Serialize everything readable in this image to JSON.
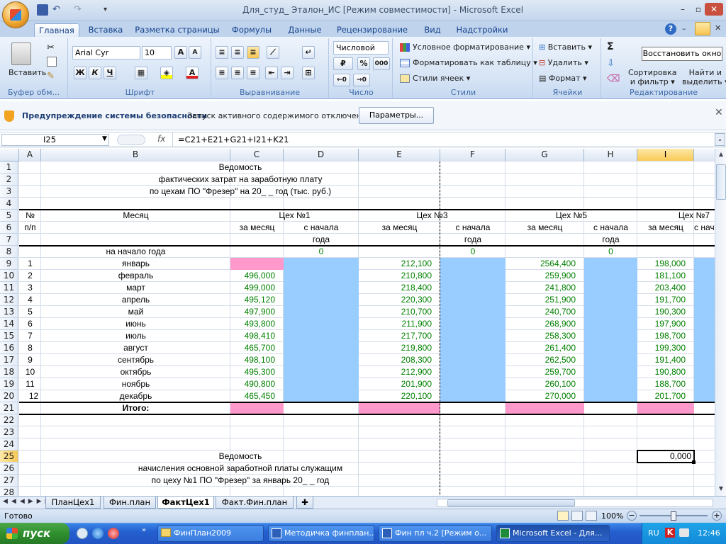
{
  "window": {
    "title": "Для_студ_ Эталон_ИС  [Режим совместимости] - Microsoft Excel"
  },
  "tabs": [
    "Главная",
    "Вставка",
    "Разметка страницы",
    "Формулы",
    "Данные",
    "Рецензирование",
    "Вид",
    "Надстройки"
  ],
  "ribbon": {
    "paste_label": "Вставить",
    "group_clipboard": "Буфер обм...",
    "font_name": "Arial Cyr",
    "font_size": "10",
    "group_font": "Шрифт",
    "group_alignment": "Выравнивание",
    "number_format": "Числовой",
    "group_number": "Число",
    "cond_format": "Условное форматирование",
    "format_table": "Форматировать как таблицу",
    "cell_styles": "Стили ячеек",
    "group_styles": "Стили",
    "insert": "Вставить",
    "delete": "Удалить",
    "format": "Формат",
    "group_cells": "Ячейки",
    "sort_filter_1": "Сортировка",
    "sort_filter_2": "и фильтр",
    "find_1": "Найти и",
    "find_2": "выделить",
    "group_editing": "Редактирование",
    "tooltip": "Восстановить окно",
    "bold": "Ж",
    "italic": "К",
    "underline": "Ч",
    "percent": "%",
    "thousands": "000",
    "sigma": "Σ"
  },
  "security": {
    "title": "Предупреждение системы безопасности",
    "message": "Запуск активного содержимого отключен.",
    "button": "Параметры..."
  },
  "formula_bar": {
    "name_box": "I25",
    "fx": "fx",
    "formula": "=C21+E21+G21+I21+K21"
  },
  "columns": [
    "A",
    "B",
    "C",
    "D",
    "E",
    "F",
    "G",
    "H",
    "I"
  ],
  "rows": [
    "1",
    "2",
    "3",
    "4",
    "5",
    "6",
    "7",
    "8",
    "9",
    "10",
    "11",
    "12",
    "13",
    "14",
    "15",
    "16",
    "17",
    "18",
    "19",
    "20",
    "21",
    "22",
    "23",
    "24",
    "25",
    "26",
    "27",
    "28"
  ],
  "sheet": {
    "title1": "Ведомость",
    "title2": "фактических затрат на заработную плату",
    "title3": "по цехам ПО \"Фрезер\" на 20_ _  год (тыс. руб.)",
    "hdr_num": "№",
    "hdr_pp": "п/п",
    "hdr_month": "Месяц",
    "shop1": "Цех №1",
    "shop3": "Цех №3",
    "shop5": "Цех №5",
    "shop7": "Цех №7",
    "per_month": "за месяц",
    "since_start_1": "с начала",
    "since_start_2": "года",
    "start_of_year": "на начало года",
    "zero": "0",
    "total": "Итого:",
    "i25": "0,000",
    "title4": "Ведомость",
    "title5": "начисления основной заработной платы служащим",
    "title6": "по цеху №1 ПО \"Фрезер\" за январь 20_ _  год",
    "data": [
      {
        "n": "1",
        "m": "январь",
        "c": "",
        "e": "212,100",
        "g": "2564,400",
        "i": "198,000"
      },
      {
        "n": "2",
        "m": "февраль",
        "c": "496,000",
        "e": "210,800",
        "g": "259,900",
        "i": "181,100"
      },
      {
        "n": "3",
        "m": "март",
        "c": "499,000",
        "e": "218,400",
        "g": "241,800",
        "i": "203,400"
      },
      {
        "n": "4",
        "m": "апрель",
        "c": "495,120",
        "e": "220,300",
        "g": "251,900",
        "i": "191,700"
      },
      {
        "n": "5",
        "m": "май",
        "c": "497,900",
        "e": "210,700",
        "g": "240,700",
        "i": "190,300"
      },
      {
        "n": "6",
        "m": "июнь",
        "c": "493,800",
        "e": "211,900",
        "g": "268,900",
        "i": "197,900"
      },
      {
        "n": "7",
        "m": "июль",
        "c": "498,410",
        "e": "217,700",
        "g": "258,300",
        "i": "198,700"
      },
      {
        "n": "8",
        "m": "август",
        "c": "465,700",
        "e": "219,800",
        "g": "261,400",
        "i": "199,300"
      },
      {
        "n": "9",
        "m": "сентябрь",
        "c": "498,100",
        "e": "208,300",
        "g": "262,500",
        "i": "191,400"
      },
      {
        "n": "10",
        "m": "октябрь",
        "c": "495,300",
        "e": "212,900",
        "g": "259,700",
        "i": "190,800"
      },
      {
        "n": "11",
        "m": "ноябрь",
        "c": "490,800",
        "e": "201,900",
        "g": "260,100",
        "i": "188,700"
      },
      {
        "n": "12",
        "m": "декабрь",
        "c": "465,450",
        "e": "220,100",
        "g": "270,000",
        "i": "201,700"
      }
    ]
  },
  "sheet_tabs": [
    "ПланЦех1",
    "Фин.план",
    "ФактЦех1",
    "Факт.Фин.план"
  ],
  "status": {
    "ready": "Готово",
    "zoom": "100%"
  },
  "taskbar": {
    "start": "пуск",
    "items": [
      "ФинПлан2009",
      "Методичка финплан...",
      "Фин пл ч.2 [Режим о...",
      "Microsoft Excel - Для..."
    ],
    "lang": "RU",
    "clock": "12:46"
  },
  "colors": {
    "blue_fill": "#99ccff",
    "pink_fill": "#ff99cc",
    "number_green": "#008000",
    "selected_header": "#f9c956"
  }
}
